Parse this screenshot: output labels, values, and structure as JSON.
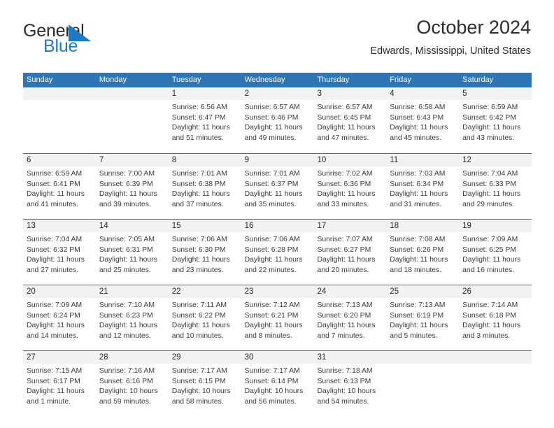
{
  "brand": {
    "name_part1": "General",
    "name_part2": "Blue",
    "mark_color": "#1f7ac4",
    "text_color": "#2b2b2b"
  },
  "header": {
    "title": "October 2024",
    "subtitle": "Edwards, Mississippi, United States"
  },
  "colors": {
    "header_blue": "#2e75b6",
    "day_band_grey": "#f2f2f2",
    "text": "#262626"
  },
  "calendar": {
    "weekdays": [
      "Sunday",
      "Monday",
      "Tuesday",
      "Wednesday",
      "Thursday",
      "Friday",
      "Saturday"
    ],
    "weeks": [
      [
        {
          "day": "",
          "sunrise": "",
          "sunset": "",
          "daylight": ""
        },
        {
          "day": "",
          "sunrise": "",
          "sunset": "",
          "daylight": ""
        },
        {
          "day": "1",
          "sunrise": "Sunrise: 6:56 AM",
          "sunset": "Sunset: 6:47 PM",
          "daylight": "Daylight: 11 hours and 51 minutes."
        },
        {
          "day": "2",
          "sunrise": "Sunrise: 6:57 AM",
          "sunset": "Sunset: 6:46 PM",
          "daylight": "Daylight: 11 hours and 49 minutes."
        },
        {
          "day": "3",
          "sunrise": "Sunrise: 6:57 AM",
          "sunset": "Sunset: 6:45 PM",
          "daylight": "Daylight: 11 hours and 47 minutes."
        },
        {
          "day": "4",
          "sunrise": "Sunrise: 6:58 AM",
          "sunset": "Sunset: 6:43 PM",
          "daylight": "Daylight: 11 hours and 45 minutes."
        },
        {
          "day": "5",
          "sunrise": "Sunrise: 6:59 AM",
          "sunset": "Sunset: 6:42 PM",
          "daylight": "Daylight: 11 hours and 43 minutes."
        }
      ],
      [
        {
          "day": "6",
          "sunrise": "Sunrise: 6:59 AM",
          "sunset": "Sunset: 6:41 PM",
          "daylight": "Daylight: 11 hours and 41 minutes."
        },
        {
          "day": "7",
          "sunrise": "Sunrise: 7:00 AM",
          "sunset": "Sunset: 6:39 PM",
          "daylight": "Daylight: 11 hours and 39 minutes."
        },
        {
          "day": "8",
          "sunrise": "Sunrise: 7:01 AM",
          "sunset": "Sunset: 6:38 PM",
          "daylight": "Daylight: 11 hours and 37 minutes."
        },
        {
          "day": "9",
          "sunrise": "Sunrise: 7:01 AM",
          "sunset": "Sunset: 6:37 PM",
          "daylight": "Daylight: 11 hours and 35 minutes."
        },
        {
          "day": "10",
          "sunrise": "Sunrise: 7:02 AM",
          "sunset": "Sunset: 6:36 PM",
          "daylight": "Daylight: 11 hours and 33 minutes."
        },
        {
          "day": "11",
          "sunrise": "Sunrise: 7:03 AM",
          "sunset": "Sunset: 6:34 PM",
          "daylight": "Daylight: 11 hours and 31 minutes."
        },
        {
          "day": "12",
          "sunrise": "Sunrise: 7:04 AM",
          "sunset": "Sunset: 6:33 PM",
          "daylight": "Daylight: 11 hours and 29 minutes."
        }
      ],
      [
        {
          "day": "13",
          "sunrise": "Sunrise: 7:04 AM",
          "sunset": "Sunset: 6:32 PM",
          "daylight": "Daylight: 11 hours and 27 minutes."
        },
        {
          "day": "14",
          "sunrise": "Sunrise: 7:05 AM",
          "sunset": "Sunset: 6:31 PM",
          "daylight": "Daylight: 11 hours and 25 minutes."
        },
        {
          "day": "15",
          "sunrise": "Sunrise: 7:06 AM",
          "sunset": "Sunset: 6:30 PM",
          "daylight": "Daylight: 11 hours and 23 minutes."
        },
        {
          "day": "16",
          "sunrise": "Sunrise: 7:06 AM",
          "sunset": "Sunset: 6:28 PM",
          "daylight": "Daylight: 11 hours and 22 minutes."
        },
        {
          "day": "17",
          "sunrise": "Sunrise: 7:07 AM",
          "sunset": "Sunset: 6:27 PM",
          "daylight": "Daylight: 11 hours and 20 minutes."
        },
        {
          "day": "18",
          "sunrise": "Sunrise: 7:08 AM",
          "sunset": "Sunset: 6:26 PM",
          "daylight": "Daylight: 11 hours and 18 minutes."
        },
        {
          "day": "19",
          "sunrise": "Sunrise: 7:09 AM",
          "sunset": "Sunset: 6:25 PM",
          "daylight": "Daylight: 11 hours and 16 minutes."
        }
      ],
      [
        {
          "day": "20",
          "sunrise": "Sunrise: 7:09 AM",
          "sunset": "Sunset: 6:24 PM",
          "daylight": "Daylight: 11 hours and 14 minutes."
        },
        {
          "day": "21",
          "sunrise": "Sunrise: 7:10 AM",
          "sunset": "Sunset: 6:23 PM",
          "daylight": "Daylight: 11 hours and 12 minutes."
        },
        {
          "day": "22",
          "sunrise": "Sunrise: 7:11 AM",
          "sunset": "Sunset: 6:22 PM",
          "daylight": "Daylight: 11 hours and 10 minutes."
        },
        {
          "day": "23",
          "sunrise": "Sunrise: 7:12 AM",
          "sunset": "Sunset: 6:21 PM",
          "daylight": "Daylight: 11 hours and 8 minutes."
        },
        {
          "day": "24",
          "sunrise": "Sunrise: 7:13 AM",
          "sunset": "Sunset: 6:20 PM",
          "daylight": "Daylight: 11 hours and 7 minutes."
        },
        {
          "day": "25",
          "sunrise": "Sunrise: 7:13 AM",
          "sunset": "Sunset: 6:19 PM",
          "daylight": "Daylight: 11 hours and 5 minutes."
        },
        {
          "day": "26",
          "sunrise": "Sunrise: 7:14 AM",
          "sunset": "Sunset: 6:18 PM",
          "daylight": "Daylight: 11 hours and 3 minutes."
        }
      ],
      [
        {
          "day": "27",
          "sunrise": "Sunrise: 7:15 AM",
          "sunset": "Sunset: 6:17 PM",
          "daylight": "Daylight: 11 hours and 1 minute."
        },
        {
          "day": "28",
          "sunrise": "Sunrise: 7:16 AM",
          "sunset": "Sunset: 6:16 PM",
          "daylight": "Daylight: 10 hours and 59 minutes."
        },
        {
          "day": "29",
          "sunrise": "Sunrise: 7:17 AM",
          "sunset": "Sunset: 6:15 PM",
          "daylight": "Daylight: 10 hours and 58 minutes."
        },
        {
          "day": "30",
          "sunrise": "Sunrise: 7:17 AM",
          "sunset": "Sunset: 6:14 PM",
          "daylight": "Daylight: 10 hours and 56 minutes."
        },
        {
          "day": "31",
          "sunrise": "Sunrise: 7:18 AM",
          "sunset": "Sunset: 6:13 PM",
          "daylight": "Daylight: 10 hours and 54 minutes."
        },
        {
          "day": "",
          "sunrise": "",
          "sunset": "",
          "daylight": ""
        },
        {
          "day": "",
          "sunrise": "",
          "sunset": "",
          "daylight": ""
        }
      ]
    ]
  }
}
